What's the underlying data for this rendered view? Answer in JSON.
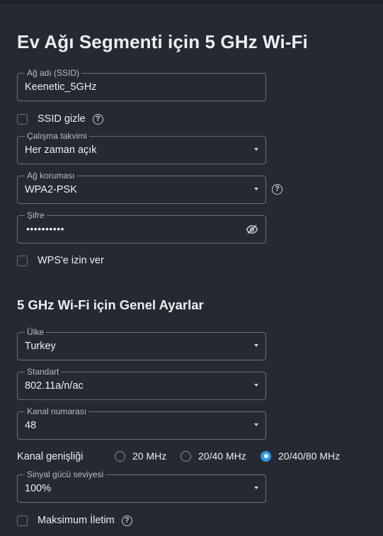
{
  "page": {
    "title": "Ev Ağı Segmenti için 5 GHz Wi-Fi",
    "section_title": "5 GHz Wi-Fi için Genel Ayarlar"
  },
  "ssid": {
    "legend": "Ağ adı (SSID)",
    "value": "Keenetic_5GHz"
  },
  "hide_ssid": {
    "label": "SSID gizle",
    "checked": false
  },
  "schedule": {
    "legend": "Çalışma takvimi",
    "value": "Her zaman açık"
  },
  "security": {
    "legend": "Ağ koruması",
    "value": "WPA2-PSK"
  },
  "password": {
    "legend": "Şifre",
    "masked_value": "••••••••••"
  },
  "wps": {
    "label": "WPS'e izin ver",
    "checked": false
  },
  "country": {
    "legend": "Ülke",
    "value": "Turkey"
  },
  "standard": {
    "legend": "Standart",
    "value": "802.11a/n/ac"
  },
  "channel": {
    "legend": "Kanal numarası",
    "value": "48"
  },
  "channel_width": {
    "label": "Kanal genişliği",
    "options": [
      "20 MHz",
      "20/40 MHz",
      "20/40/80 MHz"
    ],
    "selected": "20/40/80 MHz"
  },
  "tx_power": {
    "legend": "Sinyal gücü seviyesi",
    "value": "100%"
  },
  "max_tx": {
    "label": "Maksimum İletim",
    "checked": false
  },
  "help_glyph": "?",
  "colors": {
    "accent": "#2f9be8",
    "background": "#252a32",
    "border": "#6a707a"
  },
  "icons": [
    "help-icon",
    "eye-off-icon",
    "chevron-down-icon"
  ]
}
